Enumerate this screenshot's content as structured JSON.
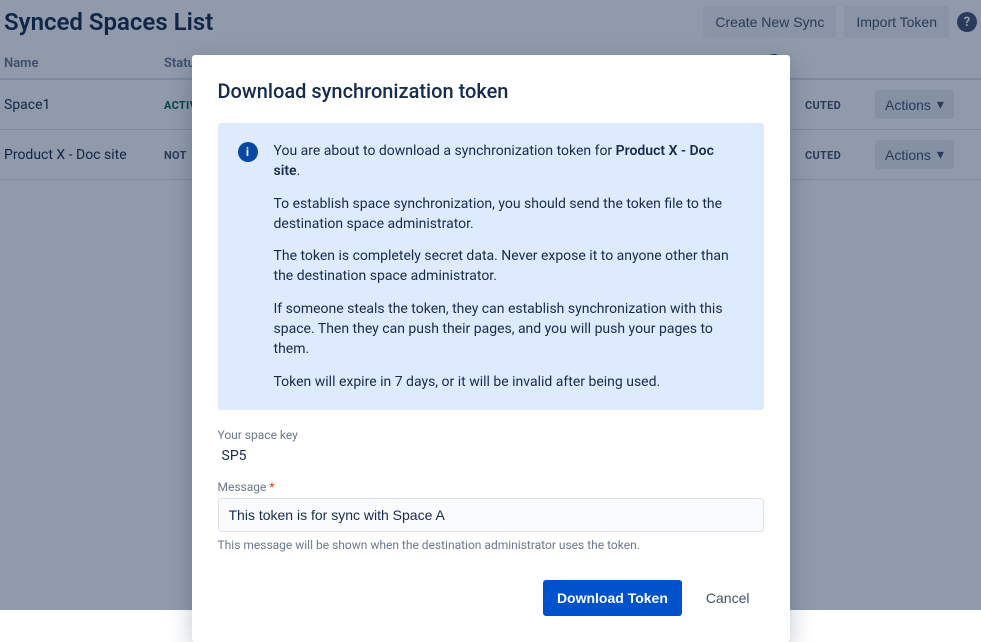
{
  "header": {
    "title": "Synced Spaces List",
    "create_label": "Create New Sync",
    "import_label": "Import Token",
    "help_tooltip": "?"
  },
  "table": {
    "columns": {
      "name": "Name",
      "status": "Status"
    },
    "extra_header_glyph": "→",
    "rows": [
      {
        "name": "Space1",
        "status": "ACTIVE",
        "status_class": "status-active",
        "tail": "CUTED",
        "actions": "Actions"
      },
      {
        "name": "Product X - Doc site",
        "status": "NOT",
        "status_class": "status-not",
        "tail": "CUTED",
        "actions": "Actions"
      }
    ]
  },
  "modal": {
    "title": "Download synchronization token",
    "info": {
      "p1_pre": "You are about to download a synchronization token for ",
      "p1_strong": "Product X - Doc site",
      "p1_post": ".",
      "p2": "To establish space synchronization, you should send the token file to the destination space administrator.",
      "p3": "The token is completely secret data. Never expose it to anyone other than the destination space administrator.",
      "p4": "If someone steals the token, they can establish synchronization with this space. Then they can push their pages, and you will push your pages to them.",
      "p5": "Token will expire in 7 days, or it will be invalid after being used."
    },
    "space_key_label": "Your space key",
    "space_key_value": "SP5",
    "message_label": "Message",
    "message_value": "This token is for sync with Space A",
    "message_hint": "This message will be shown when the destination administrator uses the token.",
    "download_label": "Download Token",
    "cancel_label": "Cancel"
  },
  "icons": {
    "info": "i",
    "chevron_down": "▾"
  }
}
